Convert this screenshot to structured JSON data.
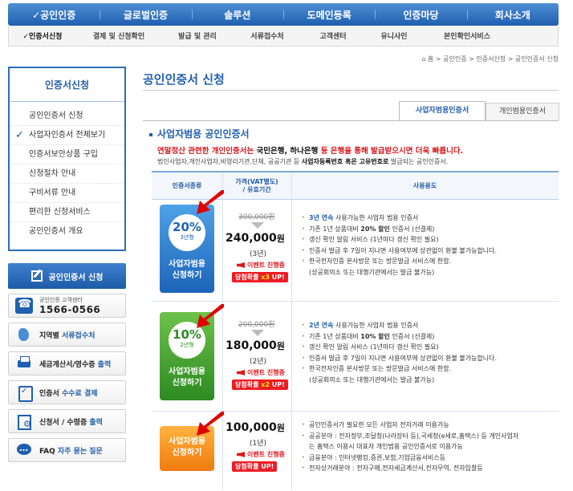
{
  "topnav": [
    "✓공인인증",
    "글로벌인증",
    "솔루션",
    "도메인등록",
    "인증마당",
    "회사소개"
  ],
  "subnav": [
    "✓인증서신청",
    "결제 및 신청확인",
    "발급 및 관리",
    "서류접수처",
    "고객센터",
    "유니사인",
    "본인확인서비스"
  ],
  "breadcrumb": "홈 > 공인인증 > 인증서신청 > 공인인증서 신청",
  "sidebar": {
    "title": "인증서신청",
    "items": [
      "공인인증서 신청",
      "사업자인증서 전체보기",
      "인증서보안상품 구입",
      "신청절차 안내",
      "구비서류 안내",
      "편리한 신청서비스",
      "공인인증서 개요"
    ],
    "apply_button": "공인인증서 신청",
    "cs_small": "공인인증 고객센터",
    "cs_phone": "1566-0566",
    "links": [
      {
        "pre": "지역별 ",
        "hl": "서류접수처"
      },
      {
        "pre": "세금계산서/영수증 ",
        "hl": "출력"
      },
      {
        "pre": "인증서 ",
        "hl": "수수료 결제"
      },
      {
        "pre": "신청서 / 수령증 ",
        "hl": "출력"
      },
      {
        "pre": "FAQ ",
        "hl": "자주 묻는 질문"
      }
    ]
  },
  "main": {
    "title": "공인인증서 신청",
    "tabs": [
      "사업자범용인증서",
      "개인범용인증서"
    ],
    "section_title": "사업자범용 공인인증서",
    "notice_red1": "연말정산 관련한 개인인증서는 ",
    "notice_black": "국민은행, 하나은행",
    "notice_red2": " 등 은행을 통해 발급받으시면 더욱 빠릅니다.",
    "desc_pre": "법인사업자,개인사업자,비영리기관,단체, 공공기관 등 ",
    "desc_bold": "사업자등록번호 혹은 고유번호로",
    "desc_post": " 발급되는 공인인증서.",
    "table_headers": {
      "type": "인증서종류",
      "price": "가격(VAT별도)\n/ 유효기간",
      "usage": "사용용도"
    },
    "rows": [
      {
        "pct": "20%",
        "years_badge": "3년형",
        "cta": [
          "사업자범용",
          "신청하기"
        ],
        "old_price": "300,000원",
        "new_price": "240,000",
        "won": "원",
        "years": "(3년)",
        "event": "이벤트 진행중",
        "points_pre": "당첨확률 ",
        "points_mul": "x3",
        "points_post": " UP!",
        "usage": [
          {
            "hl": "3년 연속",
            "t": " 사용가능한 사업자 범용 인증서"
          },
          {
            "t": "기존 1년 상품대비 ",
            "hl2": "20% 할인",
            "t2": " 인증서 (선결제)"
          },
          {
            "t": "갱신 확인 알림 서비스 (1년마다 갱신 확인 필요)"
          },
          {
            "t": "인증서 발급 후 7일이 지나면 사용여부에 상관없이 환불 불가능합니다."
          },
          {
            "t": "한국전자인증 본사방문 또는 방문발급 서비스에 한함.",
            "sub": "(상공회의소 또는 대행기관에서는 발급 불가능)"
          }
        ]
      },
      {
        "pct": "10%",
        "years_badge": "2년형",
        "cta": [
          "사업자범용",
          "신청하기"
        ],
        "old_price": "200,000원",
        "new_price": "180,000",
        "won": "원",
        "years": "(2년)",
        "event": "이벤트 진행중",
        "points_pre": "당첨확률 ",
        "points_mul": "x2",
        "points_post": " UP!",
        "usage": [
          {
            "hl": "2년 연속",
            "t": " 사용가능한 사업자 범용 인증서"
          },
          {
            "t": "기존 1년 상품대비 ",
            "hl2": "10% 할인",
            "t2": " 인증서 (선결제)"
          },
          {
            "t": "갱신 확인 알림 서비스 (1년마다 갱신 확인 필요)"
          },
          {
            "t": "인증서 발급 후 7일이 지나면 사용여부에 상관없이 환불 불가능합니다."
          },
          {
            "t": "한국전자인증 본사방문 또는 방문발급 서비스에 한함.",
            "sub": "(상공회의소 또는 대행기관에서는 발급 불가능)"
          }
        ]
      },
      {
        "cta": [
          "사업자범용",
          "신청하기"
        ],
        "new_price": "100,000",
        "won": "원",
        "years": "(1년)",
        "event": "이벤트 진행중",
        "points_pre": "당첨확률 ",
        "points_mul": "",
        "points_post": "UP!",
        "usage": [
          {
            "t": "공인인증서가 필요한 모든 사업자 전자거래 이용가능"
          },
          {
            "t": "공공분야 : 전자정부,조달청(나라장터 등),국세청(e세로,홈택스) 등 개인사업자",
            "sub": "는 홈택스 이용시 대표자 개인범용 공인인증서로 이용가능"
          },
          {
            "t": "금융분야 : 인터넷뱅킹,증권,보험,기업금융서비스등"
          },
          {
            "t": "전자상거래분야 : 전자구매,전자세금계산서,전자무역, 전자입찰등"
          }
        ]
      }
    ]
  },
  "colors": {
    "brand": "#1f5fb0",
    "accent_red": "#d8171b",
    "cta_blue": "#1c64b8",
    "cta_green": "#2d8a22",
    "cta_orange": "#f07a0c"
  }
}
